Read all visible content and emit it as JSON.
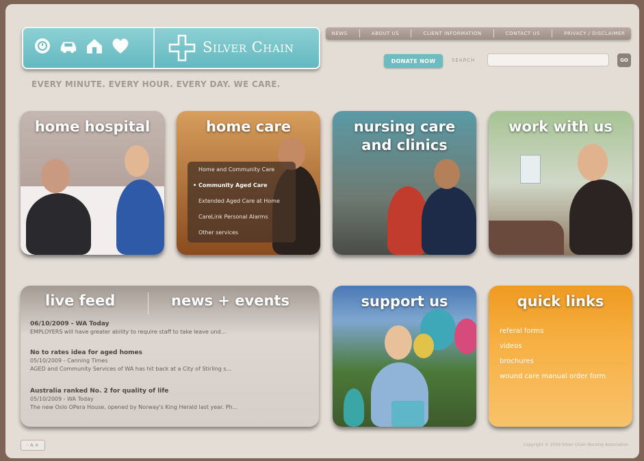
{
  "brand": {
    "name": "Silver Chain",
    "tagline": "EVERY MINUTE. EVERY HOUR. EVERY DAY. WE CARE."
  },
  "nav": [
    "NEWS",
    "ABOUT US",
    "CLIENT INFORMATION",
    "CONTACT US",
    "PRIVACY / DISCLAIMER"
  ],
  "donate_label": "DONATE NOW",
  "search": {
    "label": "SEARCH",
    "value": "",
    "go_label": "GO"
  },
  "tiles": {
    "home_hospital": "home hospital",
    "home_care": "home care",
    "nursing": "nursing care and clinics",
    "work": "work with us",
    "support": "support us",
    "quick_links": "quick links"
  },
  "home_care_menu": [
    "Home and Community Care",
    "Community Aged Care",
    "Extended Aged Care at Home",
    "CareLink Personal Alarms",
    "Other services"
  ],
  "feed": {
    "live_feed": "live feed",
    "news_events": "news + events",
    "items": [
      {
        "head": "06/10/2009 - WA Today",
        "meta": "",
        "text": "EMPLOYERS will have greater ability to require staff to take leave und..."
      },
      {
        "head": "No to rates idea for aged homes",
        "meta": "05/10/2009 - Canning Times",
        "text": "AGED and Community Services of WA has hit back at a City of Stirling s..."
      },
      {
        "head": "Australia ranked No. 2 for quality of life",
        "meta": "05/10/2009 - WA Today",
        "text": "The new Oslo OPera House, opened by Norway's King Herald last year. Ph..."
      }
    ]
  },
  "quick_links": [
    "referal forms",
    "videos",
    "brochures",
    "wound care manual order form"
  ],
  "font_size_label": "- A +",
  "copyright": "Copyright © 2009 Silver Chain Nursing Association"
}
